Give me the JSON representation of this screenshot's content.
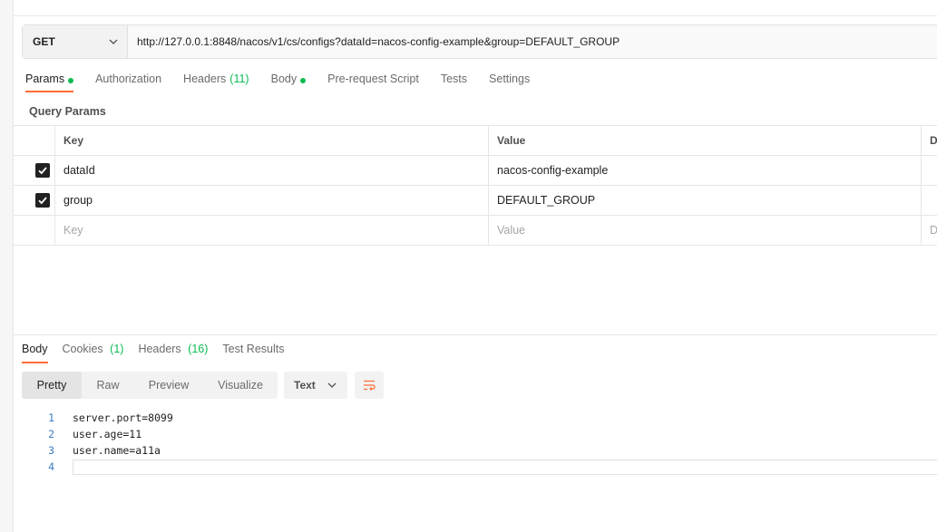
{
  "request": {
    "method": "GET",
    "url": "http://127.0.0.1:8848/nacos/v1/cs/configs?dataId=nacos-config-example&group=DEFAULT_GROUP"
  },
  "request_tabs": [
    {
      "label": "Params",
      "dot": true,
      "count": ""
    },
    {
      "label": "Authorization",
      "dot": false,
      "count": ""
    },
    {
      "label": "Headers",
      "dot": false,
      "count": "(11)"
    },
    {
      "label": "Body",
      "dot": true,
      "count": ""
    },
    {
      "label": "Pre-request Script",
      "dot": false,
      "count": ""
    },
    {
      "label": "Tests",
      "dot": false,
      "count": ""
    },
    {
      "label": "Settings",
      "dot": false,
      "count": ""
    }
  ],
  "query_params": {
    "title": "Query Params",
    "headers": {
      "key": "Key",
      "value": "Value",
      "description": "D"
    },
    "rows": [
      {
        "checked": true,
        "key": "dataId",
        "value": "nacos-config-example"
      },
      {
        "checked": true,
        "key": "group",
        "value": "DEFAULT_GROUP"
      }
    ],
    "placeholder": {
      "key": "Key",
      "value": "Value",
      "description": "D"
    }
  },
  "response_tabs": [
    {
      "label": "Body",
      "count": ""
    },
    {
      "label": "Cookies",
      "count": "(1)"
    },
    {
      "label": "Headers",
      "count": "(16)"
    },
    {
      "label": "Test Results",
      "count": ""
    }
  ],
  "view_modes": [
    "Pretty",
    "Raw",
    "Preview",
    "Visualize"
  ],
  "format": "Text",
  "code_lines": [
    {
      "n": "1",
      "text": "server.port=8099"
    },
    {
      "n": "2",
      "text": "user.age=11"
    },
    {
      "n": "3",
      "text": "user.name=a11a"
    },
    {
      "n": "4",
      "text": ""
    }
  ],
  "colors": {
    "accent": "#ff6c37",
    "success": "#0cbb52",
    "line_number": "#3b7bc0"
  }
}
